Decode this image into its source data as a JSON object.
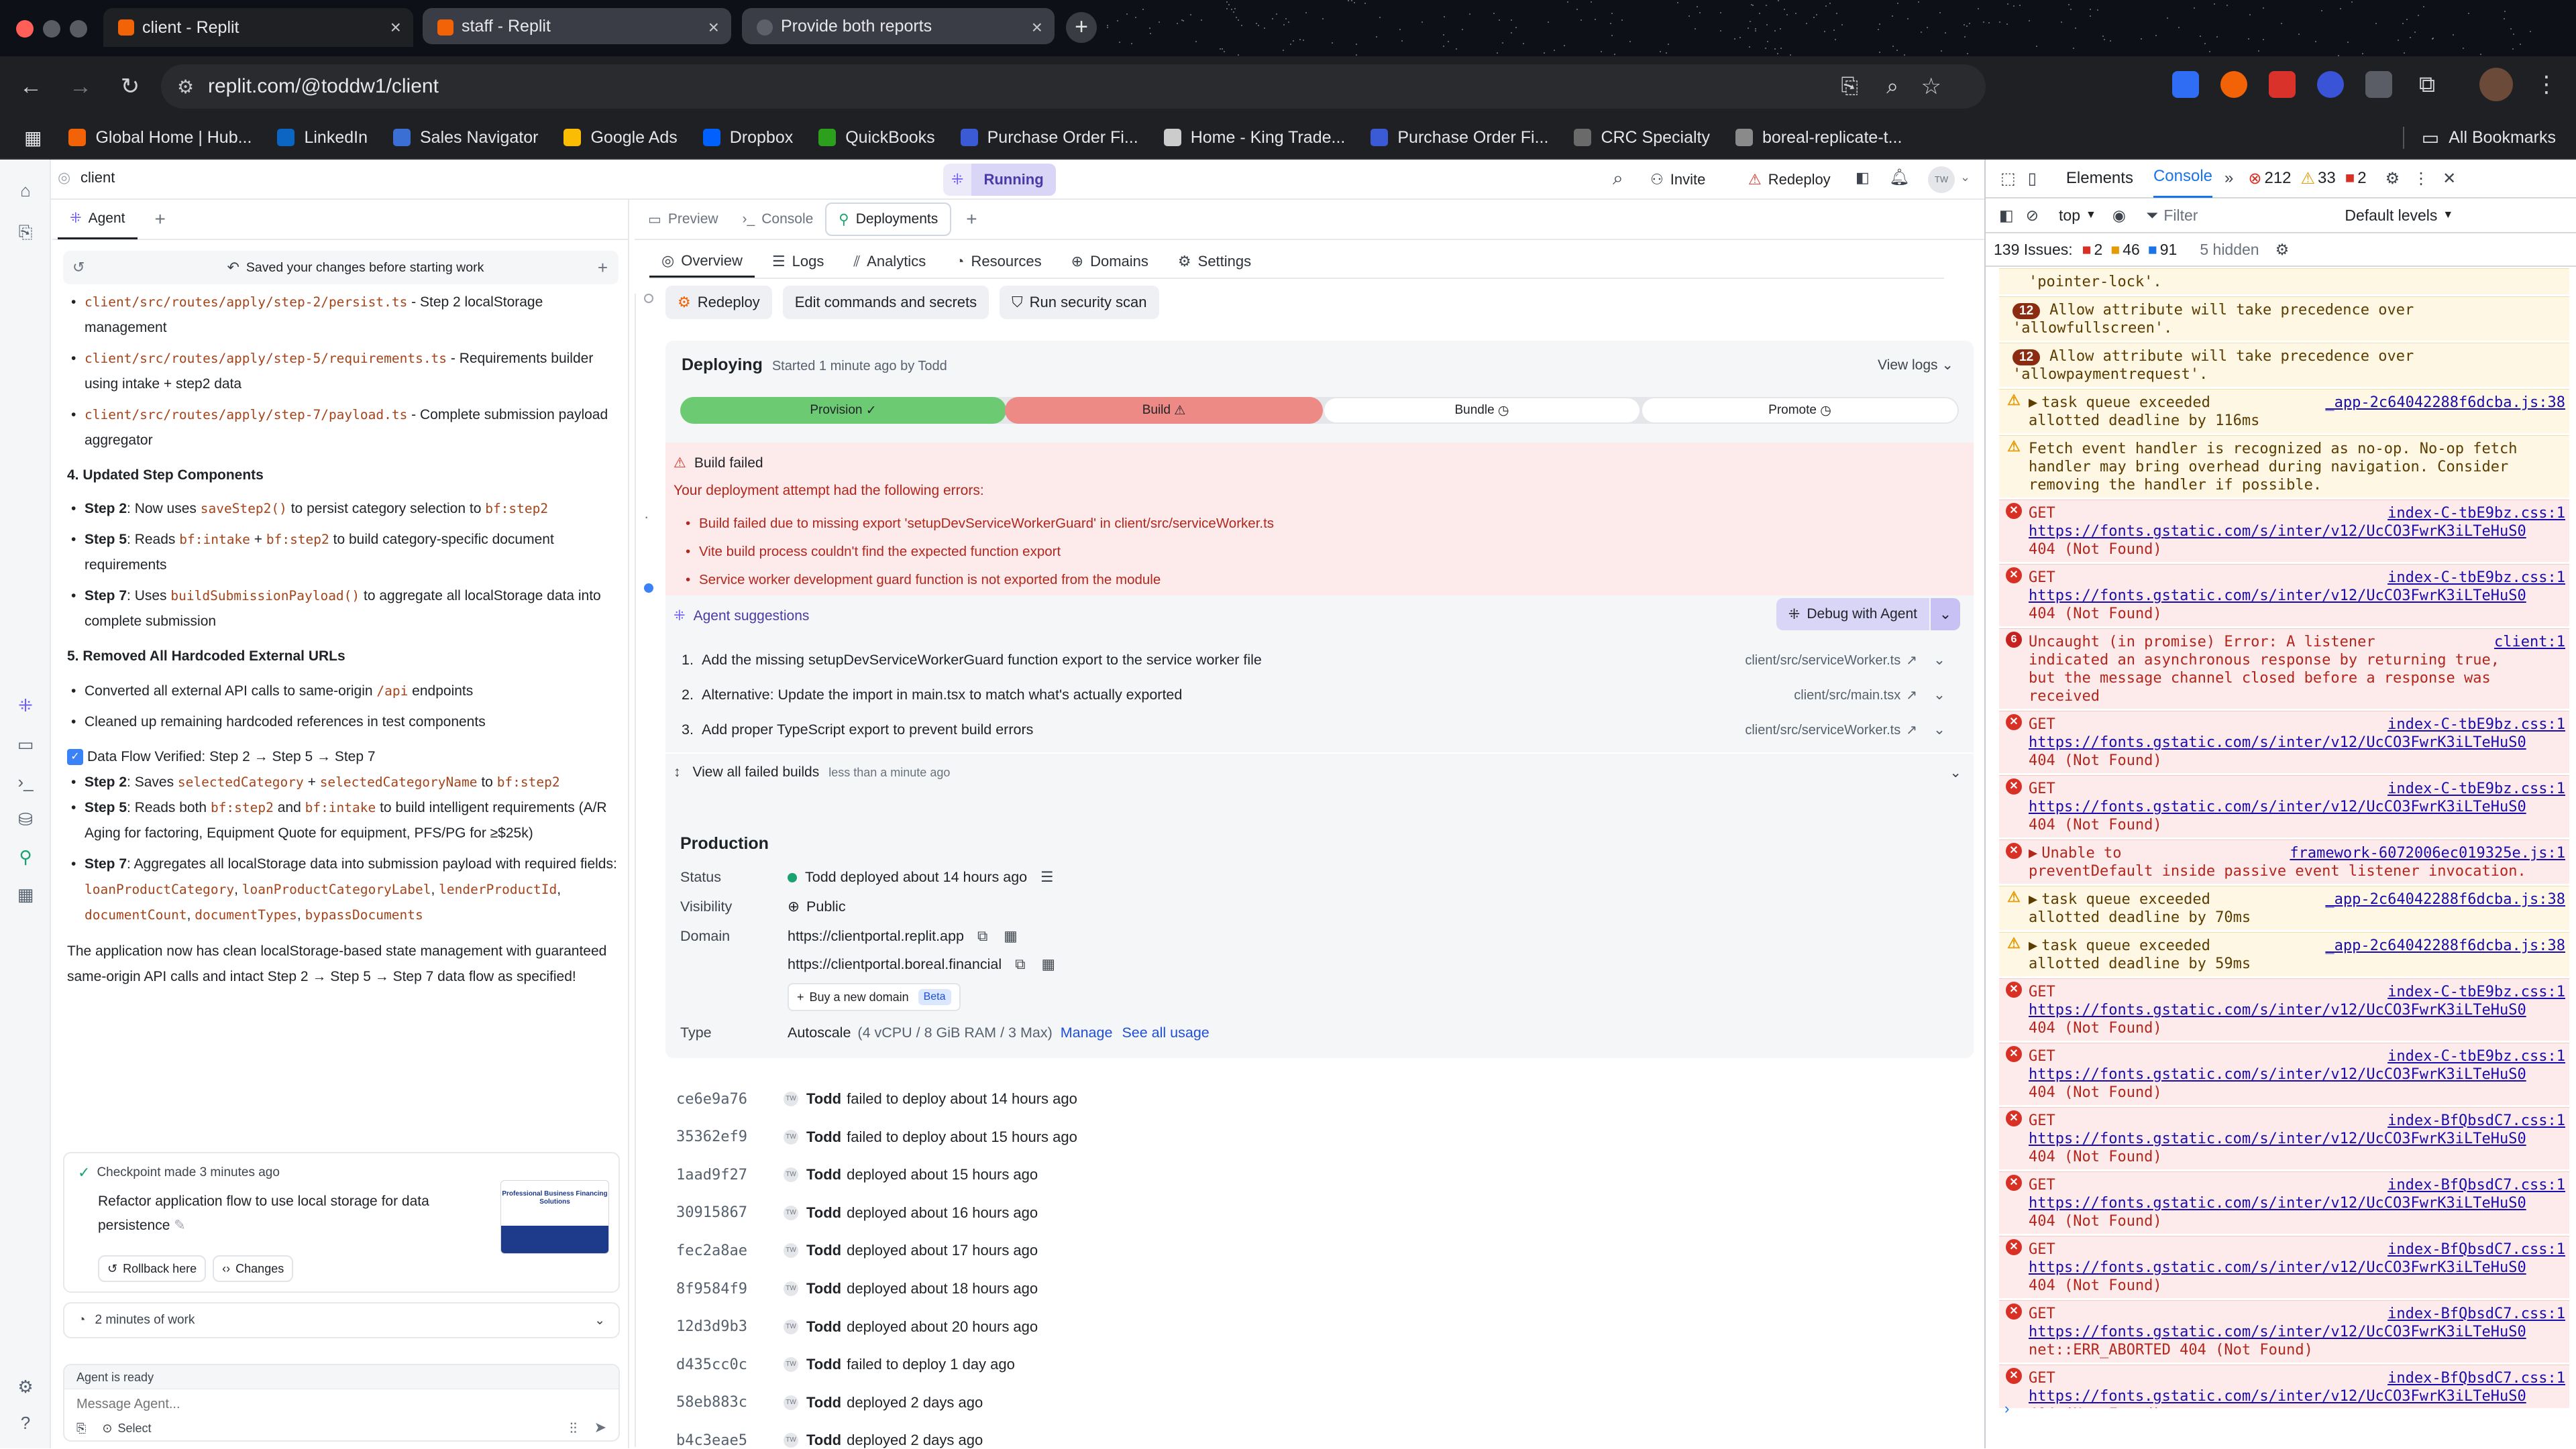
{
  "browser": {
    "tabs": [
      {
        "title": "client - Replit",
        "active": true
      },
      {
        "title": "staff - Replit",
        "active": false
      },
      {
        "title": "Provide both reports",
        "active": false
      }
    ],
    "url": "replit.com/@toddw1/client",
    "bookmarks": [
      "Global Home | Hub...",
      "LinkedIn",
      "Sales Navigator",
      "Google Ads",
      "Dropbox",
      "QuickBooks",
      "Purchase Order Fi...",
      "Home - King Trade...",
      "Purchase Order Fi...",
      "CRC Specialty",
      "boreal-replicate-t..."
    ],
    "all_bookmarks": "All Bookmarks"
  },
  "workspace": {
    "repl_name": "client",
    "status": "Running",
    "invite_label": "Invite",
    "redeploy_label": "Redeploy",
    "avatar_initials": "TW"
  },
  "agent": {
    "tab_label": "Agent",
    "saved_banner": "Saved your changes before starting work",
    "intro_items": [
      {
        "code": "client/src/routes/apply/step-2/persist.ts",
        "text": " - Step 2 localStorage management"
      },
      {
        "code": "client/src/routes/apply/step-5/requirements.ts",
        "text": " - Requirements builder using intake + step2 data"
      },
      {
        "code": "client/src/routes/apply/step-7/payload.ts",
        "text": " - Complete submission payload aggregator"
      }
    ],
    "h4": "4. Updated Step Components",
    "s4_1_step": "Step 2",
    "s4_1_a": ": Now uses ",
    "s4_1_code1": "saveStep2()",
    "s4_1_b": " to persist category selection to ",
    "s4_1_code2": "bf:step2",
    "s4_2_step": "Step 5",
    "s4_2_a": ": Reads ",
    "s4_2_code1": "bf:intake",
    "s4_2_b": " + ",
    "s4_2_code2": "bf:step2",
    "s4_2_c": " to build category-specific document requirements",
    "s4_3_step": "Step 7",
    "s4_3_a": ": Uses ",
    "s4_3_code1": "buildSubmissionPayload()",
    "s4_3_b": " to aggregate all localStorage data into complete submission",
    "h5": "5. Removed All Hardcoded External URLs",
    "s5_1_a": "Converted all external API calls to same-origin ",
    "s5_1_code": "/api",
    "s5_1_b": " endpoints",
    "s5_2": "Cleaned up remaining hardcoded references in test components",
    "flow_title": "Data Flow Verified: Step 2 → Step 5 → Step 7",
    "f1_step": "Step 2",
    "f1_a": ": Saves ",
    "f1_code1": "selectedCategory",
    "f1_b": " + ",
    "f1_code2": "selectedCategoryName",
    "f1_c": " to ",
    "f1_code3": "bf:step2",
    "f2_step": "Step 5",
    "f2_a": ": Reads both ",
    "f2_code1": "bf:step2",
    "f2_b": " and ",
    "f2_code2": "bf:intake",
    "f2_c": " to build intelligent requirements (A/R Aging for factoring, Equipment Quote for equipment, PFS/PG for ≥$25k)",
    "f3_step": "Step 7",
    "f3_a": ": Aggregates all localStorage data into submission payload with required fields: ",
    "f3_codes": [
      "loanProductCategory",
      "loanProductCategoryLabel",
      "lenderProductId",
      "documentCount",
      "documentTypes",
      "bypassDocuments"
    ],
    "summary": "The application now has clean localStorage-based state management with guaranteed same-origin API calls and intact Step 2 → Step 5 → Step 7 data flow as specified!",
    "checkpoint_meta": "Checkpoint made 3 minutes ago",
    "checkpoint_title": "Refactor application flow to use local storage for data persistence",
    "checkpoint_thumb_title": "Professional Business Financing Solutions",
    "rollback_label": "Rollback here",
    "changes_label": "Changes",
    "work_time": "2 minutes of work",
    "ready_text": "Agent is ready",
    "message_placeholder": "Message Agent...",
    "select_label": "Select"
  },
  "panel": {
    "tabs": [
      "Preview",
      "Console",
      "Deployments"
    ],
    "subtabs": [
      "Overview",
      "Logs",
      "Analytics",
      "Resources",
      "Domains",
      "Settings"
    ],
    "actions": [
      "Redeploy",
      "Edit commands and secrets",
      "Run security scan"
    ],
    "deploying_title": "Deploying",
    "deploying_meta": "Started 1 minute ago by Todd",
    "view_logs": "View logs",
    "stages": [
      "Provision",
      "Build",
      "Bundle",
      "Promote"
    ],
    "build_failed_title": "Build failed",
    "build_failed_intro": "Your deployment attempt had the following errors:",
    "errors": [
      "Build failed due to missing export 'setupDevServiceWorkerGuard' in client/src/serviceWorker.ts",
      "Vite build process couldn't find the expected function export",
      "Service worker development guard function is not exported from the module"
    ],
    "suggestions_title": "Agent suggestions",
    "debug_label": "Debug with Agent",
    "suggestions": [
      {
        "n": "1.",
        "text": "Add the missing setupDevServiceWorkerGuard function export to the service worker file",
        "path": "client/src/serviceWorker.ts"
      },
      {
        "n": "2.",
        "text": "Alternative: Update the import in main.tsx to match what's actually exported",
        "path": "client/src/main.tsx"
      },
      {
        "n": "3.",
        "text": "Add proper TypeScript export to prevent build errors",
        "path": "client/src/serviceWorker.ts"
      }
    ],
    "failed_builds_label": "View all failed builds",
    "failed_builds_time": "less than a minute ago",
    "production_title": "Production",
    "status_label": "Status",
    "status_value": "Todd deployed about 14 hours ago",
    "visibility_label": "Visibility",
    "visibility_value": "Public",
    "domain_label": "Domain",
    "domains": [
      "https://clientportal.replit.app",
      "https://clientportal.boreal.financial"
    ],
    "buy_domain": "Buy a new domain",
    "beta": "Beta",
    "type_label": "Type",
    "type_value": "Autoscale",
    "type_spec": "(4 vCPU / 8 GiB RAM / 3 Max)",
    "manage": "Manage",
    "see_usage": "See all usage",
    "history": [
      {
        "hash": "ce6e9a76",
        "text": "failed to deploy about 14 hours ago"
      },
      {
        "hash": "35362ef9",
        "text": "failed to deploy about 15 hours ago"
      },
      {
        "hash": "1aad9f27",
        "text": "deployed about 15 hours ago"
      },
      {
        "hash": "30915867",
        "text": "deployed about 16 hours ago"
      },
      {
        "hash": "fec2a8ae",
        "text": "deployed about 17 hours ago"
      },
      {
        "hash": "8f9584f9",
        "text": "deployed about 18 hours ago"
      },
      {
        "hash": "12d3d9b3",
        "text": "deployed about 20 hours ago"
      },
      {
        "hash": "d435cc0c",
        "text": "failed to deploy 1 day ago"
      },
      {
        "hash": "58eb883c",
        "text": "deployed 2 days ago"
      },
      {
        "hash": "b4c3eae5",
        "text": "deployed 2 days ago"
      }
    ],
    "history_user": "Todd",
    "avatar_initials": "TW"
  },
  "devtools": {
    "tabs": [
      "Elements",
      "Console"
    ],
    "error_count": "212",
    "warning_count": "33",
    "info_count": "2",
    "context": "top",
    "filter": "Filter",
    "levels": "Default levels",
    "issues_count": "139 Issues:",
    "issues_err": "2",
    "issues_warn": "46",
    "issues_info": "91",
    "hidden": "5 hidden",
    "messages": [
      {
        "kind": "warn",
        "lines": [
          "'pointer-lock'."
        ]
      },
      {
        "kind": "warn",
        "badge": "12",
        "lines": [
          "Allow attribute will take precedence over",
          "'allowfullscreen'."
        ]
      },
      {
        "kind": "warn",
        "badge": "12",
        "lines": [
          "Allow attribute will take precedence over",
          "'allowpaymentrequest'."
        ]
      },
      {
        "kind": "warn",
        "tri": true,
        "src": "_app-2c64042288f6dcba.js:38",
        "lines": [
          "task queue exceeded",
          "allotted deadline by 116ms"
        ]
      },
      {
        "kind": "warn",
        "lines": [
          "Fetch event handler is recognized as no-op. No-op fetch",
          "handler may bring overhead during navigation. Consider",
          "removing the handler if possible."
        ]
      },
      {
        "kind": "err",
        "src": "index-C-tbE9bz.css:1",
        "lines": [
          "GET"
        ],
        "link": "https://fonts.gstatic.com/s/inter/v12/UcCO3FwrK3iLTeHuS0",
        "tail": "404 (Not Found)"
      },
      {
        "kind": "err",
        "src": "index-C-tbE9bz.css:1",
        "lines": [
          "GET"
        ],
        "link": "https://fonts.gstatic.com/s/inter/v12/UcCO3FwrK3iLTeHuS0",
        "tail": "404 (Not Found)"
      },
      {
        "kind": "err",
        "num": "6",
        "src": "client:1",
        "lines": [
          "Uncaught (in promise) Error: A listener",
          "indicated an asynchronous response by returning true,",
          "but the message channel closed before a response was",
          "received"
        ]
      },
      {
        "kind": "err",
        "src": "index-C-tbE9bz.css:1",
        "lines": [
          "GET"
        ],
        "link": "https://fonts.gstatic.com/s/inter/v12/UcCO3FwrK3iLTeHuS0",
        "tail": "404 (Not Found)"
      },
      {
        "kind": "err",
        "src": "index-C-tbE9bz.css:1",
        "lines": [
          "GET"
        ],
        "link": "https://fonts.gstatic.com/s/inter/v12/UcCO3FwrK3iLTeHuS0",
        "tail": "404 (Not Found)"
      },
      {
        "kind": "err",
        "tri": true,
        "src": "framework-6072006ec019325e.js:1",
        "lines": [
          "Unable to",
          "preventDefault inside passive event listener invocation."
        ]
      },
      {
        "kind": "warn",
        "tri": true,
        "src": "_app-2c64042288f6dcba.js:38",
        "lines": [
          "task queue exceeded",
          "allotted deadline by 70ms"
        ]
      },
      {
        "kind": "warn",
        "tri": true,
        "src": "_app-2c64042288f6dcba.js:38",
        "lines": [
          "task queue exceeded",
          "allotted deadline by 59ms"
        ]
      },
      {
        "kind": "err",
        "src": "index-C-tbE9bz.css:1",
        "lines": [
          "GET"
        ],
        "link": "https://fonts.gstatic.com/s/inter/v12/UcCO3FwrK3iLTeHuS0",
        "tail": "404 (Not Found)"
      },
      {
        "kind": "err",
        "src": "index-C-tbE9bz.css:1",
        "lines": [
          "GET"
        ],
        "link": "https://fonts.gstatic.com/s/inter/v12/UcCO3FwrK3iLTeHuS0",
        "tail": "404 (Not Found)"
      },
      {
        "kind": "err",
        "src": "index-BfQbsdC7.css:1",
        "lines": [
          "GET"
        ],
        "link": "https://fonts.gstatic.com/s/inter/v12/UcCO3FwrK3iLTeHuS0",
        "tail": "404 (Not Found)"
      },
      {
        "kind": "err",
        "src": "index-BfQbsdC7.css:1",
        "lines": [
          "GET"
        ],
        "link": "https://fonts.gstatic.com/s/inter/v12/UcCO3FwrK3iLTeHuS0",
        "tail": "404 (Not Found)"
      },
      {
        "kind": "err",
        "src": "index-BfQbsdC7.css:1",
        "lines": [
          "GET"
        ],
        "link": "https://fonts.gstatic.com/s/inter/v12/UcCO3FwrK3iLTeHuS0",
        "tail": "404 (Not Found)"
      },
      {
        "kind": "err",
        "src": "index-BfQbsdC7.css:1",
        "lines": [
          "GET"
        ],
        "link": "https://fonts.gstatic.com/s/inter/v12/UcCO3FwrK3iLTeHuS0",
        "tail": "net::ERR_ABORTED 404 (Not Found)"
      },
      {
        "kind": "err",
        "src": "index-BfQbsdC7.css:1",
        "lines": [
          "GET"
        ],
        "link": "https://fonts.gstatic.com/s/inter/v12/UcCO3FwrK3iLTeHuS0",
        "tail": "404 (Not Found)"
      }
    ]
  },
  "colors": {
    "brand": "#f26207",
    "provision": "#6ccb72",
    "build_failed": "#ee8a86",
    "error_bg": "#fcebea",
    "warn_bg": "#fdf7e3",
    "running": "#d9d5f7"
  }
}
